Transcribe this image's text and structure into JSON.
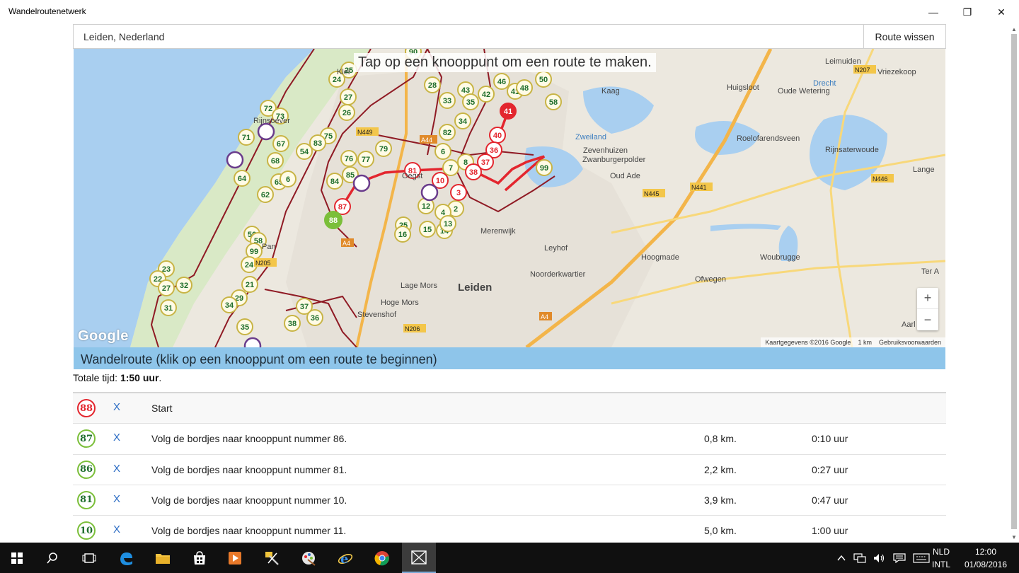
{
  "window": {
    "title": "Wandelroutenetwerk",
    "controls": [
      "—",
      "❐",
      "✕"
    ]
  },
  "search": {
    "value": "Leiden, Nederland",
    "clear_label": "Route wissen"
  },
  "map": {
    "hint": "Tap op een knooppunt om een route te maken.",
    "attribution": "Kaartgegevens ©2016 Google",
    "scale": "1 km",
    "terms": "Gebruiksvoorwaarden",
    "logo": "Google",
    "zoom_in": "+",
    "zoom_out": "−",
    "places": [
      "Leimuiden",
      "Vriezekoop",
      "Huigsloot",
      "Kaag",
      "Oude Wetering",
      "Roelofarendsveen",
      "Rijnsaterwoude",
      "Zevenhuizen",
      "Zwanburgerpolder",
      "Oud Ade",
      "Lange",
      "Merenwijk",
      "Leyhof",
      "Hoogmade",
      "Woubrugge",
      "Ter A",
      "Noorderkwartier",
      "Ofwegen",
      "Lage Mors",
      "Leiden",
      "Hoge Mors",
      "Stevenshof",
      "Aarl",
      "Rijnsoever",
      "Klei",
      "Pan",
      "Zweiland",
      "Drecht",
      "Oegst"
    ],
    "roads": [
      "N207",
      "N445",
      "N446",
      "N449",
      "A44",
      "N206",
      "A4",
      "N441",
      "N205",
      "A4"
    ],
    "nodes_green": [
      "90",
      "25",
      "24",
      "28",
      "46",
      "41",
      "48",
      "50",
      "58",
      "43",
      "42",
      "72",
      "73",
      "27",
      "26",
      "33",
      "35",
      "34",
      "71",
      "75",
      "83",
      "82",
      "67",
      "54",
      "76",
      "77",
      "79",
      "6",
      "68",
      "64",
      "65",
      "6",
      "85",
      "84",
      "7",
      "8",
      "99",
      "62",
      "12",
      "2",
      "4",
      "25",
      "16",
      "15",
      "14",
      "13",
      "56",
      "58",
      "99",
      "24",
      "23",
      "22",
      "27",
      "32",
      "21",
      "31",
      "29",
      "34",
      "35",
      "37",
      "36",
      "38"
    ],
    "nodes_red": [
      "41",
      "40",
      "36",
      "37",
      "38",
      "81",
      "10",
      "3",
      "87"
    ],
    "start_node": "88"
  },
  "route": {
    "header": "Wandelroute (klik op een knooppunt om een route te beginnen)",
    "total_label": "Totale tijd: ",
    "total_value": "1:50 uur",
    "total_suffix": ".",
    "remove_label": "X",
    "steps": [
      {
        "node": "88",
        "instruction": "Start",
        "distance": "",
        "time": ""
      },
      {
        "node": "87",
        "instruction": "Volg de bordjes naar knooppunt nummer 86.",
        "distance": "0,8 km.",
        "time": "0:10 uur"
      },
      {
        "node": "86",
        "instruction": "Volg de bordjes naar knooppunt nummer 81.",
        "distance": "2,2 km.",
        "time": "0:27 uur"
      },
      {
        "node": "81",
        "instruction": "Volg de bordjes naar knooppunt nummer 10.",
        "distance": "3,9 km.",
        "time": "0:47 uur"
      },
      {
        "node": "10",
        "instruction": "Volg de bordjes naar knooppunt nummer 11.",
        "distance": "5,0 km.",
        "time": "1:00 uur"
      }
    ]
  },
  "taskbar": {
    "lang_top": "NLD",
    "lang_bottom": "INTL",
    "time": "12:00",
    "date": "01/08/2016"
  },
  "colors": {
    "route_red": "#e3262e",
    "node_green": "#7bbf3a",
    "header_blue": "#8ec5ea",
    "link_blue": "#2a6bc4"
  }
}
